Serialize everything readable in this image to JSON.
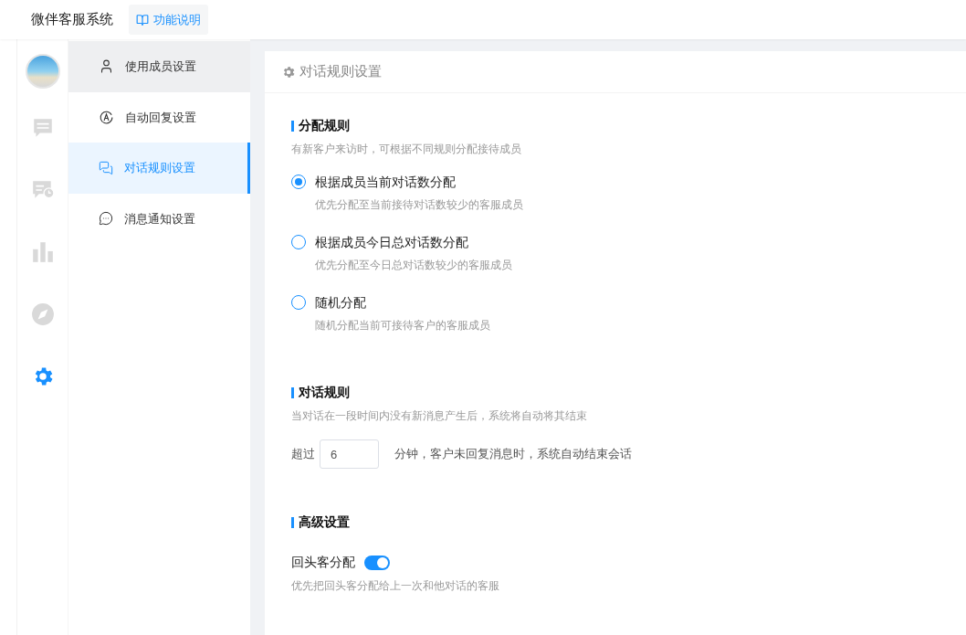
{
  "header": {
    "title": "微伴客服系统",
    "help_button": "功能说明"
  },
  "rail": [
    {
      "kind": "avatar",
      "selected": false
    },
    {
      "kind": "chat",
      "selected": false
    },
    {
      "kind": "chat-clock",
      "selected": false
    },
    {
      "kind": "stats",
      "selected": false
    },
    {
      "kind": "compass",
      "selected": false
    },
    {
      "kind": "settings",
      "selected": true
    }
  ],
  "menu": [
    {
      "kind": "user",
      "label": "使用成员设置",
      "selected": false,
      "hovered": true
    },
    {
      "kind": "auto",
      "label": "自动回复设置",
      "selected": false,
      "hovered": false
    },
    {
      "kind": "dialog",
      "label": "对话规则设置",
      "selected": true,
      "hovered": false
    },
    {
      "kind": "message",
      "label": "消息通知设置",
      "selected": false,
      "hovered": false
    }
  ],
  "panel": {
    "title": "对话规则设置",
    "assign": {
      "heading": "分配规则",
      "description": "有新客户来访时，可根据不同规则分配接待成员",
      "options": [
        {
          "label": "根据成员当前对话数分配",
          "hint": "优先分配至当前接待对话数较少的客服成员",
          "selected": true
        },
        {
          "label": "根据成员今日总对话数分配",
          "hint": "优先分配至今日总对话数较少的客服成员",
          "selected": false
        },
        {
          "label": "随机分配",
          "hint": "随机分配当前可接待客户的客服成员",
          "selected": false
        }
      ]
    },
    "dialog": {
      "heading": "对话规则",
      "description": "当对话在一段时间内没有新消息产生后，系统将自动将其结束",
      "prefix": "超过",
      "value": "6",
      "suffix": "分钟，客户未回复消息时，系统自动结束会话"
    },
    "advanced": {
      "heading": "高级设置",
      "toggle_label": "回头客分配",
      "on": true,
      "hint": "优先把回头客分配给上一次和他对话的客服"
    }
  }
}
